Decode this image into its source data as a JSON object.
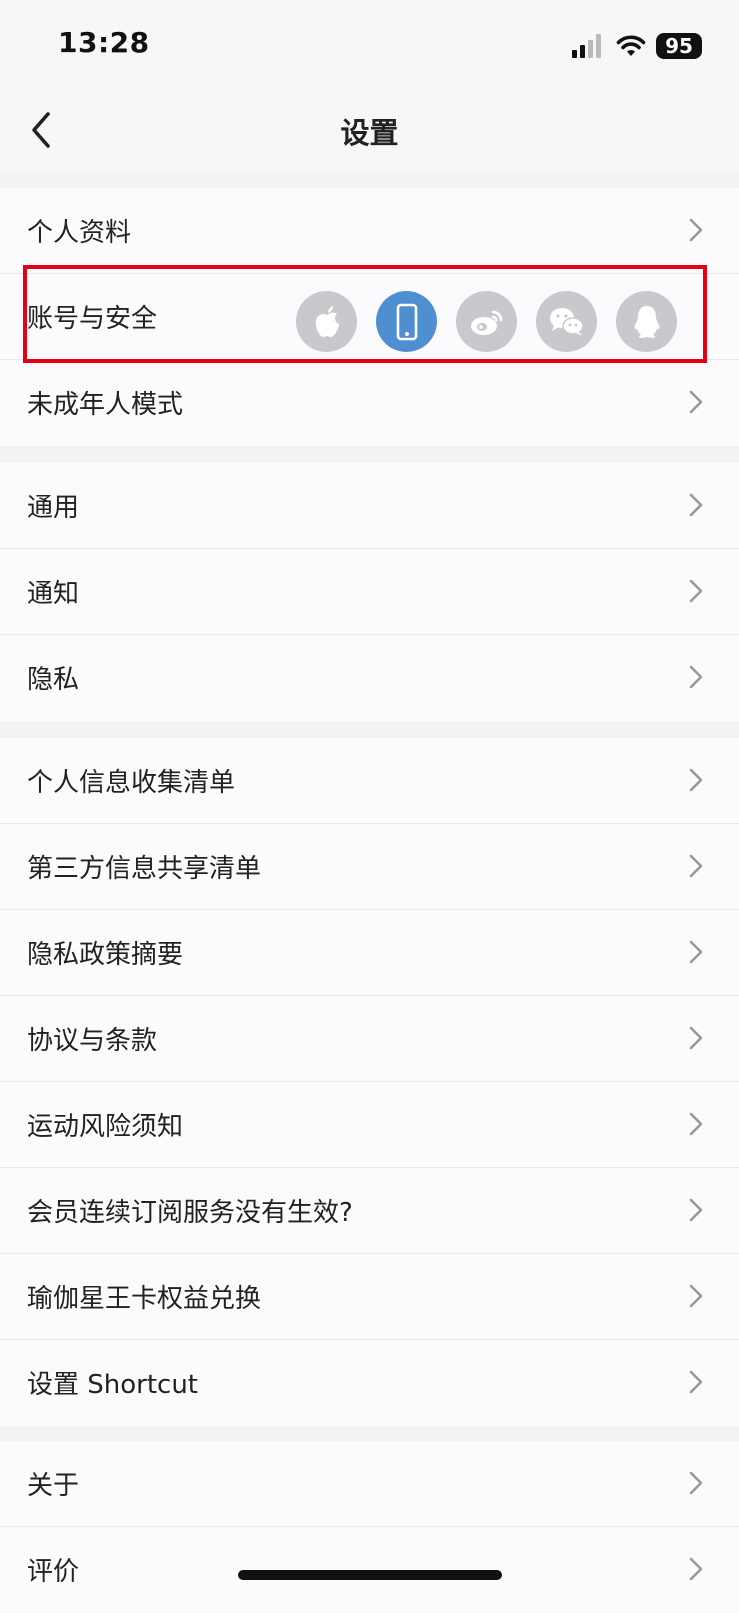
{
  "status": {
    "time": "13:28",
    "battery": "95"
  },
  "header": {
    "title": "设置"
  },
  "sections": [
    [
      {
        "label": "个人资料"
      },
      {
        "label": "账号与安全"
      },
      {
        "label": "未成年人模式"
      }
    ],
    [
      {
        "label": "通用"
      },
      {
        "label": "通知"
      },
      {
        "label": "隐私"
      }
    ],
    [
      {
        "label": "个人信息收集清单"
      },
      {
        "label": "第三方信息共享清单"
      },
      {
        "label": "隐私政策摘要"
      },
      {
        "label": "协议与条款"
      },
      {
        "label": "运动风险须知"
      },
      {
        "label": "会员连续订阅服务没有生效?"
      },
      {
        "label": "瑜伽星王卡权益兑换"
      },
      {
        "label": "设置 Shortcut"
      }
    ],
    [
      {
        "label": "关于"
      },
      {
        "label": "评价"
      }
    ]
  ],
  "account_icons": [
    "apple-icon",
    "phone-icon",
    "weibo-icon",
    "wechat-icon",
    "qq-icon"
  ],
  "active_account_icon": "phone-icon",
  "colors": {
    "highlight": "#e60012",
    "active_icon": "#4f8fd1",
    "inactive_icon": "#c9c9cd"
  }
}
